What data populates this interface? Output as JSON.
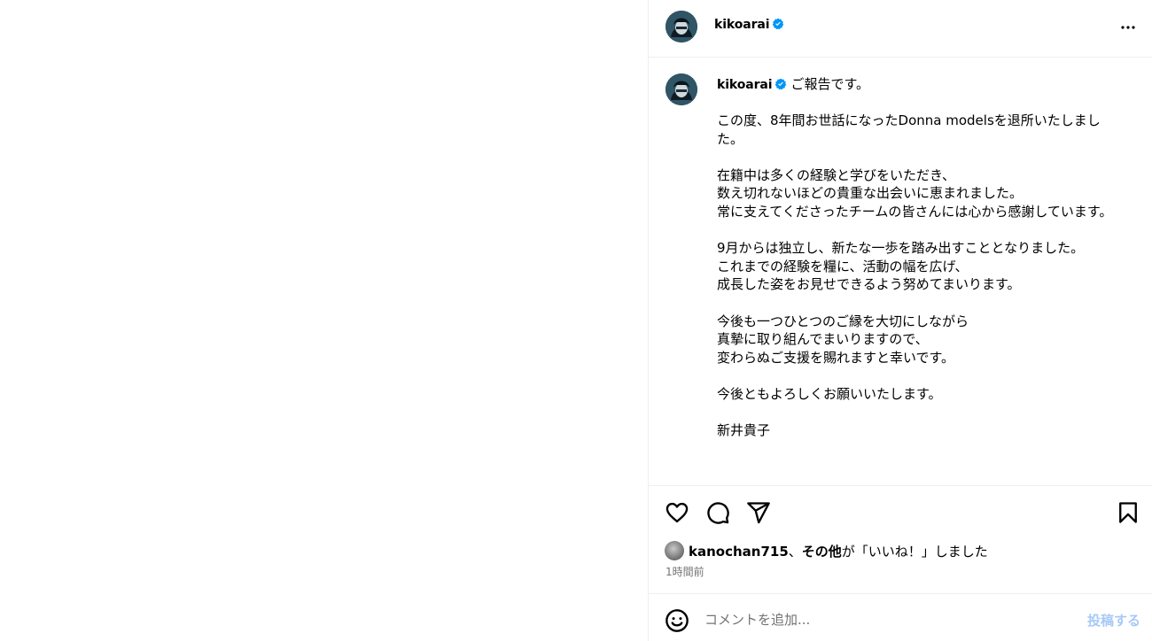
{
  "header": {
    "username": "kikoarai"
  },
  "caption": {
    "username": "kikoarai",
    "first_line": "ご報告です。",
    "paragraphs": [
      "この度、8年間お世話になったDonna modelsを退所いたしました。",
      "在籍中は多くの経験と学びをいただき、\n数え切れないほどの貴重な出会いに恵まれました。\n常に支えてくださったチームの皆さんには心から感謝しています。",
      "9月からは独立し、新たな一歩を踏み出すこととなりました。\nこれまでの経験を糧に、活動の幅を広げ、\n成長した姿をお見せできるよう努めてまいります。",
      "今後も一つひとつのご縁を大切にしながら\n真摯に取り組んでまいりますので、\n変わらぬご支援を賜れますと幸いです。",
      "今後ともよろしくお願いいたします。",
      "新井貴子"
    ]
  },
  "likes": {
    "liker": "kanochan715",
    "separator": "、",
    "others": "その他",
    "suffix": "が「いいね！」しました"
  },
  "timestamp": "1時間前",
  "comment": {
    "placeholder": "コメントを追加...",
    "post_label": "投稿する"
  },
  "icons": {
    "verified": "verified-badge-icon",
    "more": "more-options-icon",
    "like": "heart-icon",
    "comment": "comment-bubble-icon",
    "share": "paper-plane-icon",
    "save": "bookmark-icon",
    "emoji": "emoji-smiley-icon"
  },
  "colors": {
    "verified": "#0095f6",
    "muted_text": "#737373",
    "post_button_disabled": "#a7c9f7",
    "divider": "#efefef"
  }
}
